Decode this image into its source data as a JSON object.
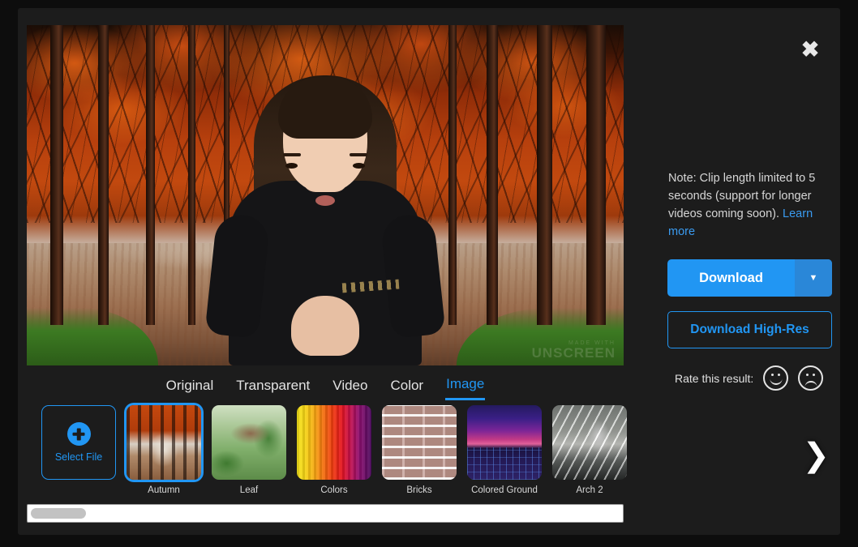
{
  "theme": {
    "background": "#0d0d0d",
    "dialog_bg": "#1c1c1c",
    "accent": "#2196f3",
    "text": "#e3e3e3"
  },
  "dialog": {
    "close_icon": "close-icon"
  },
  "preview": {
    "description": "Person composited on autumn tree-lined path background",
    "watermark": "UNSCREEN",
    "watermark_small": "MADE WITH"
  },
  "tabs": [
    {
      "label": "Original",
      "active": false
    },
    {
      "label": "Transparent",
      "active": false
    },
    {
      "label": "Video",
      "active": false
    },
    {
      "label": "Color",
      "active": false
    },
    {
      "label": "Image",
      "active": true
    }
  ],
  "thumbnails": {
    "select_file_label": "Select File",
    "select_file_icon": "plus-circle-icon",
    "next_arrow_icon": "chevron-right-icon",
    "items": [
      {
        "label": "Autumn",
        "art": "art-autumn",
        "selected": true
      },
      {
        "label": "Leaf",
        "art": "art-leaf",
        "selected": false
      },
      {
        "label": "Colors",
        "art": "art-colors",
        "selected": false
      },
      {
        "label": "Bricks",
        "art": "art-bricks",
        "selected": false
      },
      {
        "label": "Colored Ground",
        "art": "art-ground",
        "selected": false
      },
      {
        "label": "Arch 2",
        "art": "art-arch",
        "selected": false
      }
    ]
  },
  "scrollbar": {
    "orientation": "horizontal",
    "thumb_position": "left"
  },
  "panel": {
    "note_text": "Note: Clip length limited to 5 seconds (support for longer videos coming soon). ",
    "note_link": "Learn more",
    "download_label": "Download",
    "download_caret_icon": "chevron-down-icon",
    "highres_label": "Download High-Res",
    "rate_label": "Rate this result:",
    "rate_positive_icon": "smiley-happy-icon",
    "rate_negative_icon": "smiley-sad-icon"
  }
}
